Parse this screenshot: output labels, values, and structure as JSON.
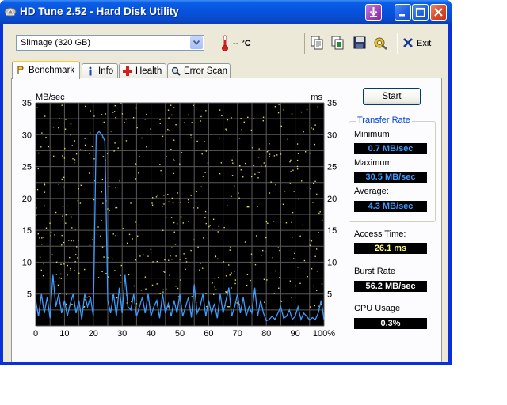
{
  "window": {
    "title": "HD Tune 2.52 - Hard Disk Utility",
    "controls": [
      "download",
      "minimize",
      "maximize",
      "close"
    ]
  },
  "toolbar": {
    "drive": {
      "value": "SiImage  (320 GB)"
    },
    "temperature": "-- °C",
    "buttons": [
      "copy-text-icon",
      "copy-info-icon",
      "save-icon",
      "options-icon"
    ],
    "exit_label": "Exit"
  },
  "tabs": [
    {
      "label": "Benchmark",
      "icon": "benchmark-icon",
      "active": true
    },
    {
      "label": "Info",
      "icon": "info-icon",
      "active": false
    },
    {
      "label": "Health",
      "icon": "health-icon",
      "active": false
    },
    {
      "label": "Error Scan",
      "icon": "error-scan-icon",
      "active": false
    }
  ],
  "benchmark": {
    "start_label": "Start",
    "transfer_rate": {
      "title": "Transfer Rate",
      "minimum_label": "Minimum",
      "minimum_value": "0.7 MB/sec",
      "maximum_label": "Maximum",
      "maximum_value": "30.5 MB/sec",
      "average_label": "Average:",
      "average_value": "4.3 MB/sec"
    },
    "access_time_label": "Access Time:",
    "access_time_value": "26.1 ms",
    "burst_rate_label": "Burst Rate",
    "burst_rate_value": "56.2 MB/sec",
    "cpu_usage_label": "CPU Usage",
    "cpu_usage_value": "0.3%"
  },
  "colors": {
    "transfer_line": "#3c9cff",
    "access_dots": "#e0e040",
    "value_blue": "#3c9cff",
    "value_yellow": "#ffff80",
    "value_white": "#ffffff"
  },
  "chart_data": {
    "type": "line",
    "ylabel_left": "MB/sec",
    "ylabel_right": "ms",
    "ylim": [
      0,
      35
    ],
    "y2lim": [
      0,
      35
    ],
    "xlim": [
      0,
      100
    ],
    "x_ticks": [
      "0",
      "10",
      "20",
      "30",
      "40",
      "50",
      "60",
      "70",
      "80",
      "90",
      "100%"
    ],
    "y_ticks": [
      "35",
      "30",
      "25",
      "20",
      "15",
      "10",
      "5"
    ],
    "y2_ticks": [
      "35",
      "30",
      "25",
      "20",
      "15",
      "10",
      "5"
    ],
    "grid": true,
    "series": [
      {
        "x": [
          0,
          1,
          2,
          3,
          4,
          5,
          6,
          7,
          8,
          9,
          10,
          11,
          12,
          13,
          14,
          15,
          16,
          17,
          18,
          19,
          20,
          21,
          22,
          23,
          24,
          25,
          26,
          27,
          28,
          29,
          30,
          31,
          32,
          33,
          34,
          35,
          36,
          37,
          38,
          39,
          40,
          41,
          42,
          43,
          44,
          45,
          46,
          47,
          48,
          49,
          50,
          51,
          52,
          53,
          54,
          55,
          56,
          57,
          58,
          59,
          60,
          61,
          62,
          63,
          64,
          65,
          66,
          67,
          68,
          69,
          70,
          71,
          72,
          73,
          74,
          75,
          76,
          77,
          78,
          79,
          80,
          81,
          82,
          83,
          84,
          85,
          86,
          87,
          88,
          89,
          90,
          91,
          92,
          93,
          94,
          95,
          96,
          97,
          98,
          99,
          100
        ],
        "y": [
          4,
          1.5,
          5,
          2,
          4.5,
          1.2,
          8,
          3,
          5,
          2,
          4,
          1.5,
          3.5,
          5,
          2,
          4,
          1,
          5,
          3,
          4.5,
          1.5,
          30,
          30.5,
          30,
          29,
          4,
          2,
          5,
          1.5,
          6,
          2,
          8,
          3,
          2.5,
          5,
          1.5,
          3,
          4.5,
          2,
          5,
          1.5,
          3,
          4,
          1.2,
          5,
          2,
          3.5,
          1.5,
          4,
          2,
          5,
          1.5,
          3,
          4.5,
          1.3,
          6.5,
          2,
          3,
          5,
          1.5,
          4,
          2,
          3.5,
          1.2,
          5,
          2,
          4,
          6,
          1.5,
          3,
          5,
          2,
          4.5,
          1.5,
          3,
          2,
          6,
          1.5,
          4,
          2,
          0.8,
          1,
          1.5,
          1,
          2,
          3,
          1.2,
          1.5,
          2.5,
          1,
          1.5,
          3,
          1,
          2,
          1.5,
          0.9,
          1.3,
          1,
          2,
          4,
          1
        ]
      }
    ]
  }
}
